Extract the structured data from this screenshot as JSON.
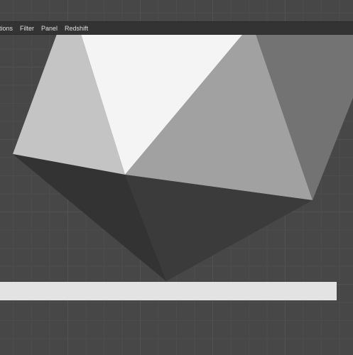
{
  "menubar": {
    "items": [
      {
        "label": "tions"
      },
      {
        "label": "Filter"
      },
      {
        "label": "Panel"
      },
      {
        "label": "Redshift"
      }
    ]
  },
  "viewport": {
    "background_color": "#474747",
    "object": "low-poly-polyhedron",
    "face_colors": [
      "#f4f4f4",
      "#c4c4c4",
      "#a0a0a0",
      "#737373",
      "#333333",
      "#3a3a3a"
    ]
  },
  "bottom_bar": {
    "color": "#e3e3e3"
  }
}
